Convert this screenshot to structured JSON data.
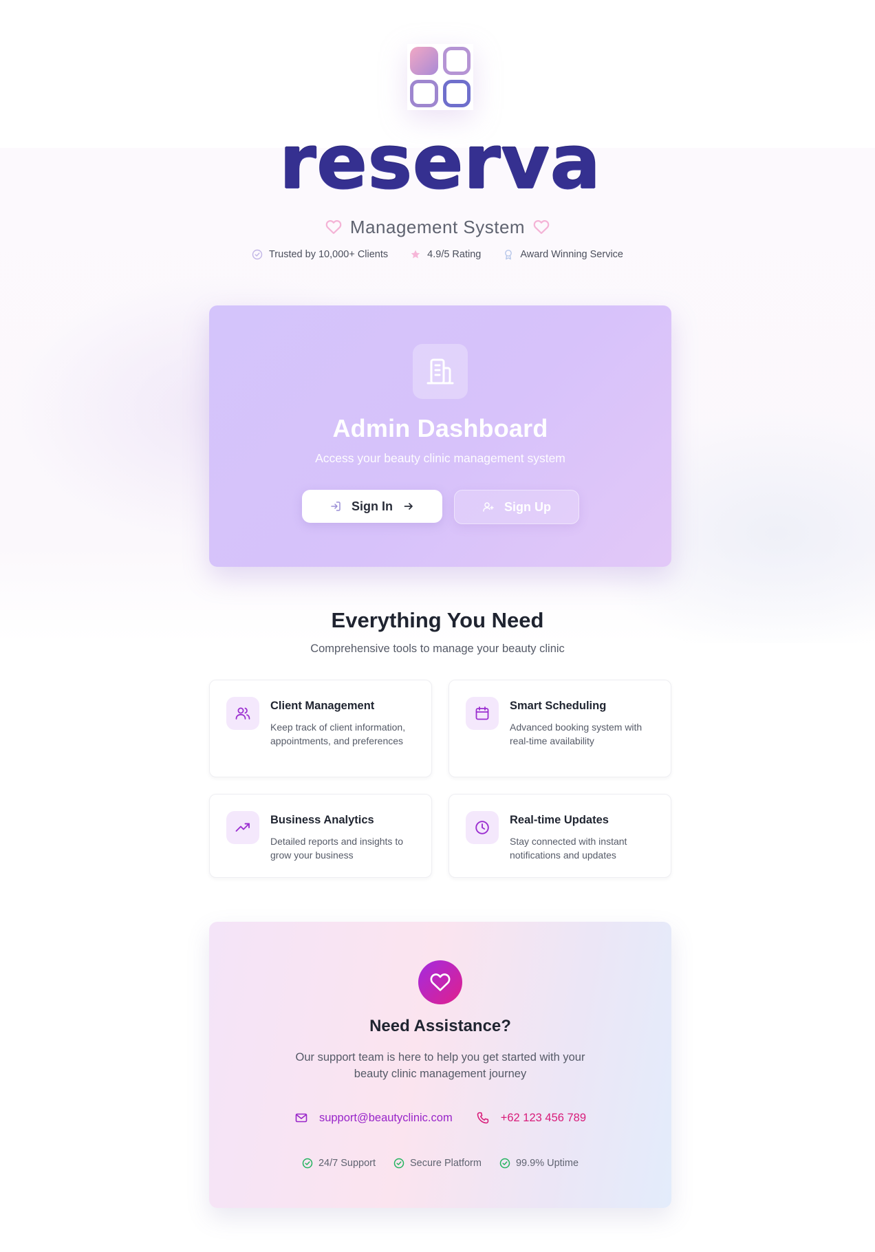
{
  "brand": {
    "wordmark": "reserva",
    "subtitle": "Management System"
  },
  "trust_badges": [
    {
      "icon": "check-circle-icon",
      "label": "Trusted by 10,000+ Clients"
    },
    {
      "icon": "star-icon",
      "label": "4.9/5 Rating"
    },
    {
      "icon": "award-icon",
      "label": "Award Winning Service"
    }
  ],
  "admin": {
    "icon": "building-icon",
    "title": "Admin Dashboard",
    "subtitle": "Access your beauty clinic management system",
    "signin_label": "Sign In",
    "signup_label": "Sign Up"
  },
  "features": {
    "title": "Everything You Need",
    "subtitle": "Comprehensive tools to manage your beauty clinic",
    "items": [
      {
        "icon": "users-icon",
        "title": "Client Management",
        "description": "Keep track of client information, appointments, and preferences"
      },
      {
        "icon": "calendar-icon",
        "title": "Smart Scheduling",
        "description": "Advanced booking system with real-time availability"
      },
      {
        "icon": "trending-up-icon",
        "title": "Business Analytics",
        "description": "Detailed reports and insights to grow your business"
      },
      {
        "icon": "clock-icon",
        "title": "Real-time Updates",
        "description": "Stay connected with instant notifications and updates"
      }
    ]
  },
  "assistance": {
    "icon": "heart-icon",
    "title": "Need Assistance?",
    "description": "Our support team is here to help you get started with your beauty clinic management journey",
    "email": "support@beautyclinic.com",
    "phone": "+62 123 456 789",
    "badges": [
      "24/7 Support",
      "Secure Platform",
      "99.9% Uptime"
    ]
  },
  "colors": {
    "brand_navy": "#353090",
    "accent_purple": "#9824c9",
    "accent_pink": "#d81b79",
    "success_green": "#22b35e"
  }
}
